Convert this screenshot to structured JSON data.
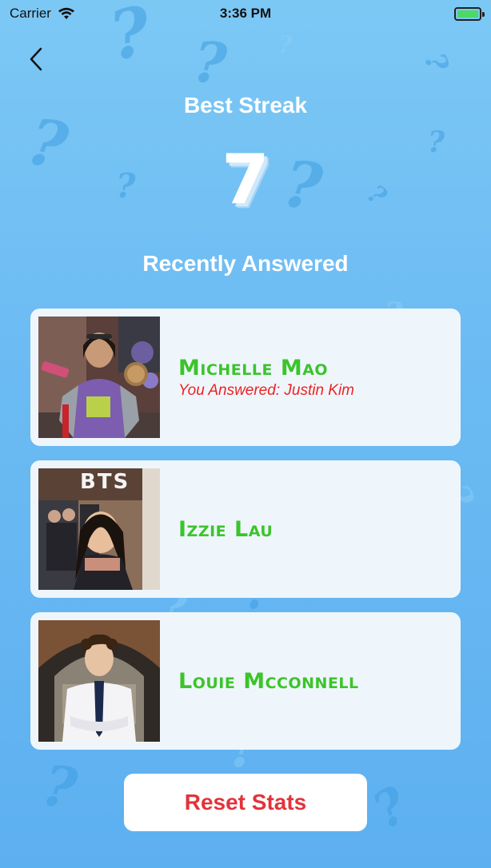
{
  "status_bar": {
    "carrier": "Carrier",
    "time": "3:36 PM",
    "battery_level": 1.0
  },
  "header": {
    "back_icon": "chevron-left-icon",
    "title": "Best Streak",
    "streak_value": "7"
  },
  "recent": {
    "title": "Recently Answered",
    "items": [
      {
        "name": "Michelle Mao",
        "answered": "You Answered: Justin Kim"
      },
      {
        "name": "Izzie Lau",
        "answered": ""
      },
      {
        "name": "Louie Mcconnell",
        "answered": ""
      }
    ]
  },
  "actions": {
    "reset_label": "Reset Stats"
  },
  "colors": {
    "background": "#6cbbf3",
    "name": "#3cc42a",
    "answered": "#e22222",
    "reset_text": "#e2333b"
  },
  "photo_captions": {
    "bts": "BTS"
  }
}
